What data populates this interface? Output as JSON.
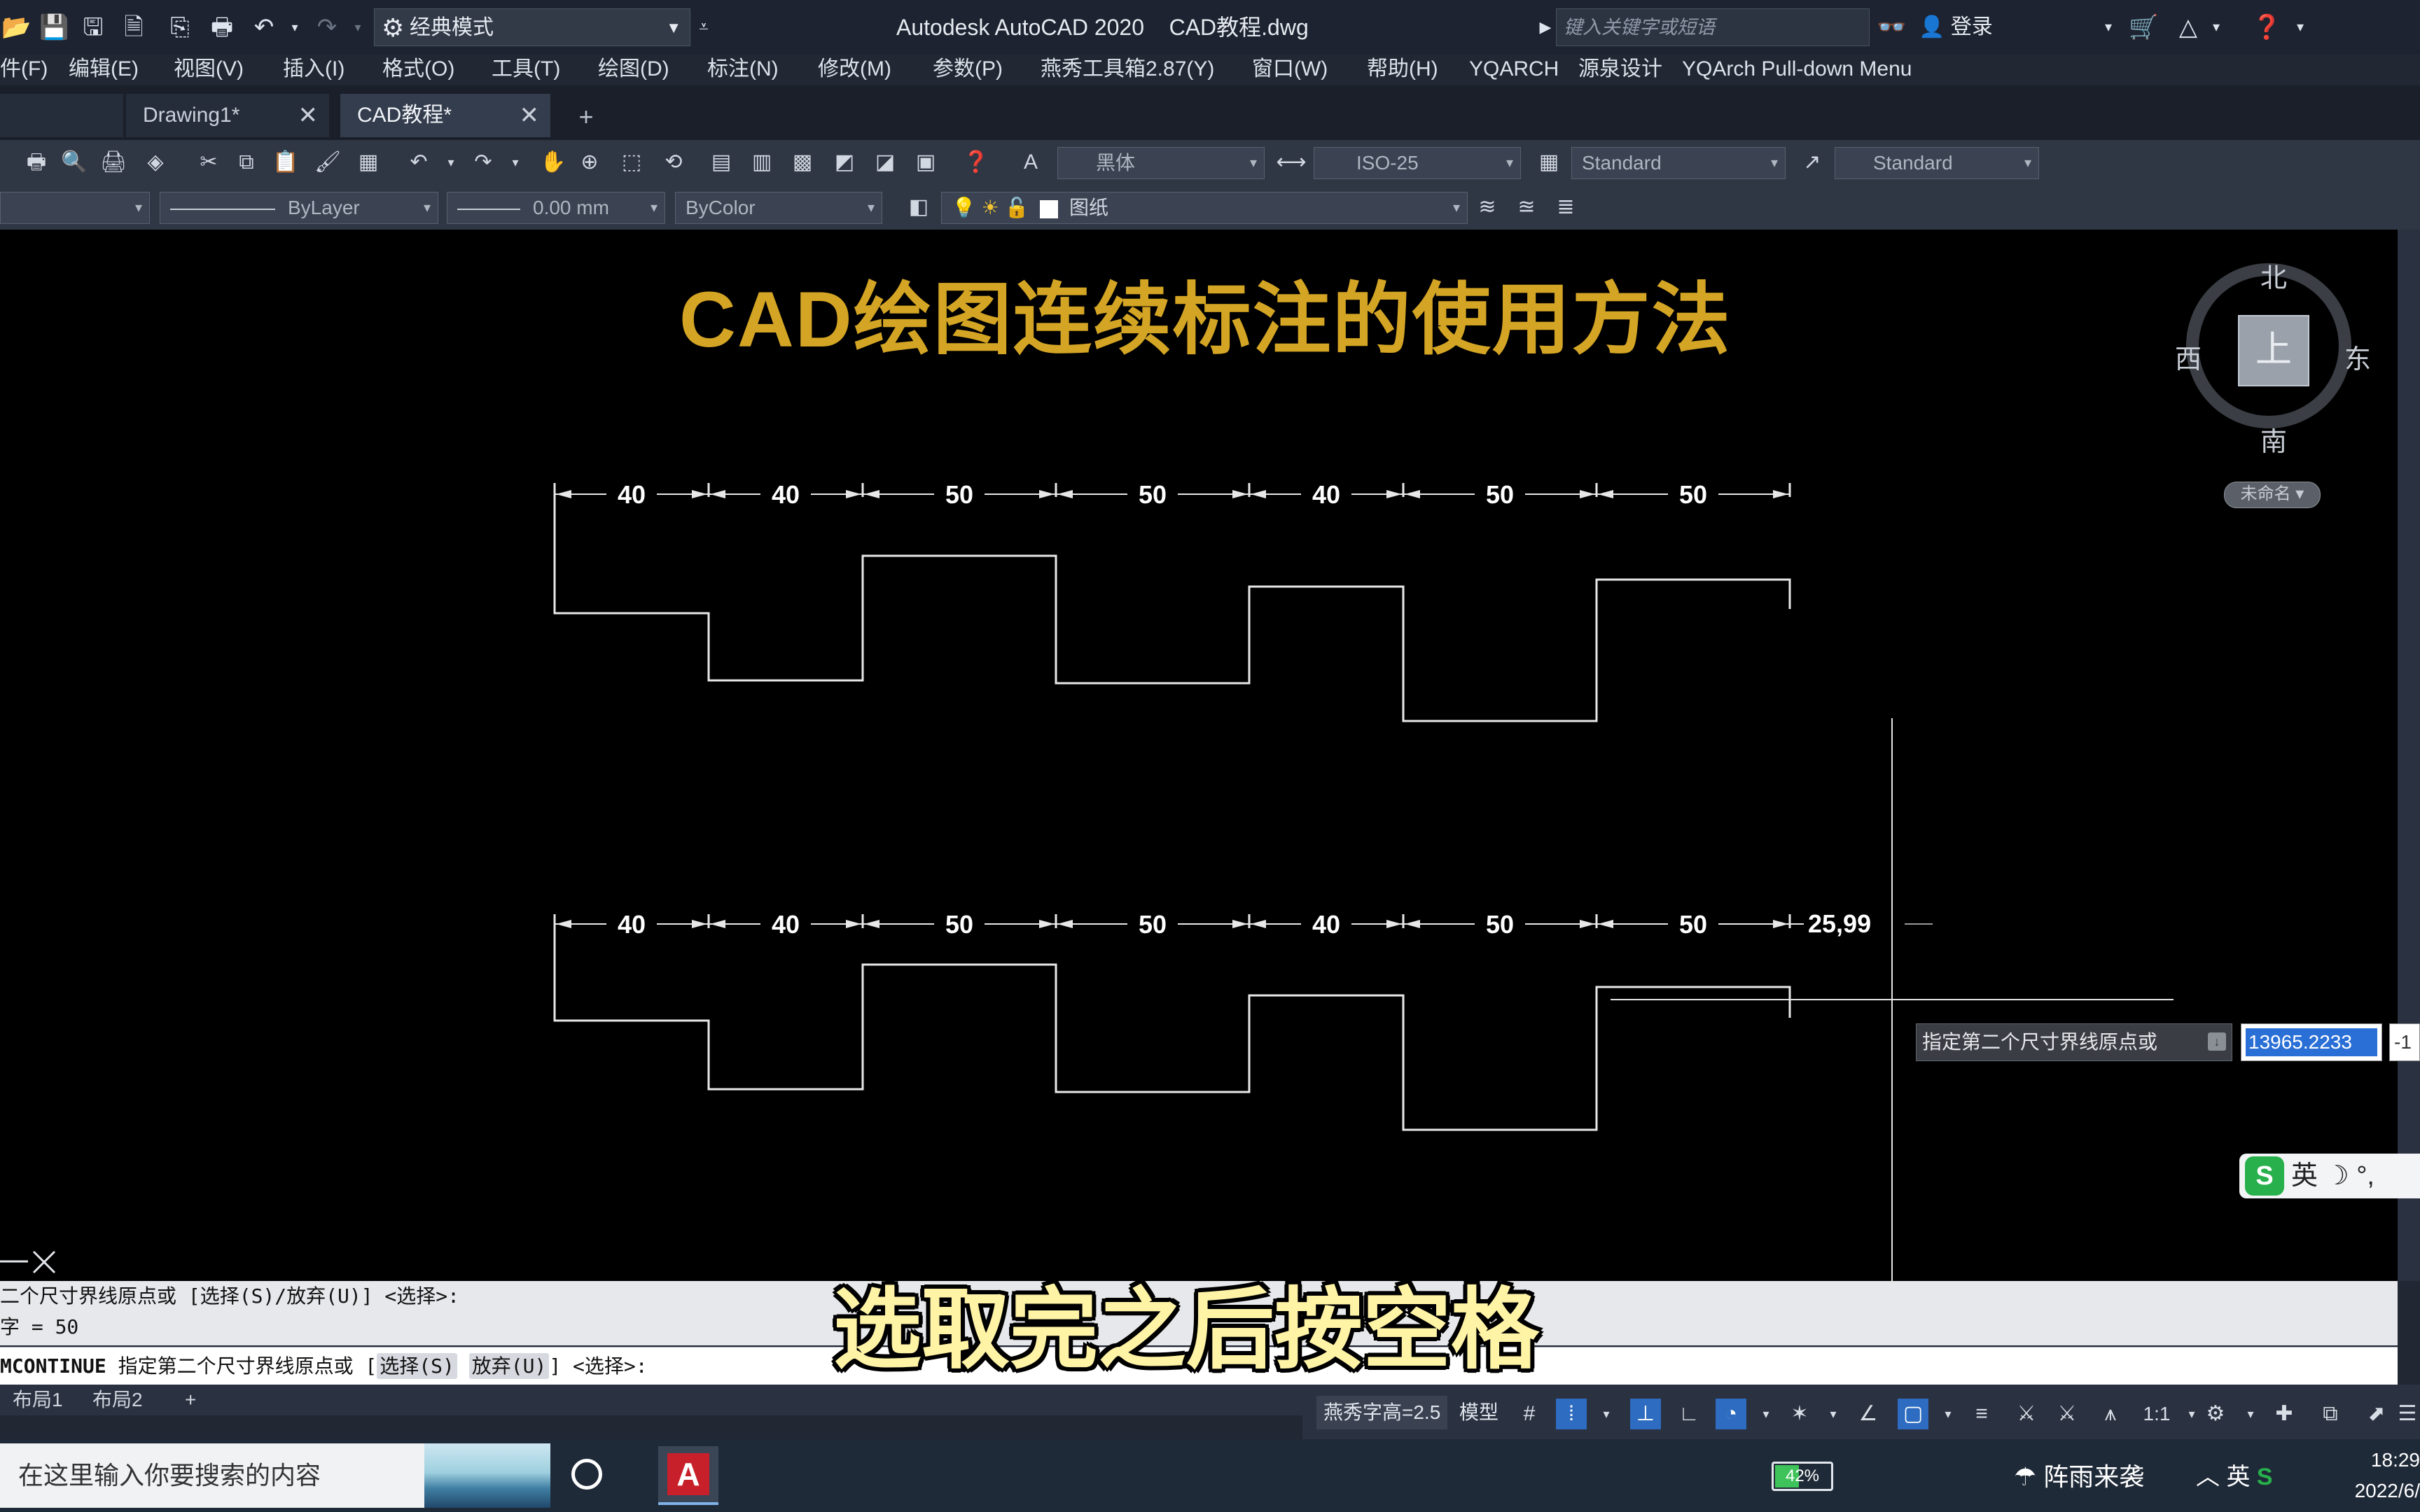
{
  "titlebar": {
    "workspace": "经典模式",
    "app_name": "Autodesk AutoCAD 2020",
    "file_name": "CAD教程.dwg",
    "search_placeholder": "键入关键字或短语",
    "login": "登录"
  },
  "menubar": {
    "items": [
      "件(F)",
      "编辑(E)",
      "视图(V)",
      "插入(I)",
      "格式(O)",
      "工具(T)",
      "绘图(D)",
      "标注(N)",
      "修改(M)",
      "参数(P)",
      "燕秀工具箱2.87(Y)",
      "窗口(W)",
      "帮助(H)",
      "YQARCH",
      "源泉设计",
      "YQArch Pull-down Menu"
    ]
  },
  "tabs": {
    "items": [
      {
        "label": "Drawing1*",
        "close": "✕"
      },
      {
        "label": "CAD教程*",
        "close": "✕"
      }
    ],
    "add": "+"
  },
  "toolbar": {
    "text_style_font": "黑体",
    "dim_style": "ISO-25",
    "table_style": "Standard",
    "multileader_style": "Standard",
    "linetype": "ByLayer",
    "lineweight": "0.00 mm",
    "plot_color": "ByColor",
    "layer": "图纸"
  },
  "drawing": {
    "title": "CAD绘图连续标注的使用方法",
    "top_dims": [
      "40",
      "40",
      "50",
      "50",
      "40",
      "50",
      "50"
    ],
    "bottom_dims": [
      "40",
      "40",
      "50",
      "50",
      "40",
      "50",
      "50"
    ],
    "preview_dim": "25,99"
  },
  "viewcube": {
    "north": "北",
    "south": "南",
    "east": "东",
    "west": "西",
    "face": "上",
    "wcs": "未命名"
  },
  "dynamic_input": {
    "prompt": "指定第二个尺寸界线原点或",
    "value": "13965.2233",
    "value2": "-1"
  },
  "ime": {
    "label": "英",
    "icons": "☽ °,"
  },
  "command": {
    "history1": "二个尺寸界线原点或 [选择(S)/放弃(U)] <选择>:",
    "history2": "字 = 50",
    "cmd_name": "MCONTINUE",
    "prompt_text": " 指定第二个尺寸界线原点或 [",
    "option1": "选择(S)",
    "option2": "放弃(U)",
    "prompt_end": "] <选择>:"
  },
  "subtitle": "选取完之后按空格",
  "layout_tabs": [
    "布局1",
    "布局2"
  ],
  "layout_add": "+",
  "statusbar": {
    "text_height": "燕秀字高=2.5",
    "model": "模型",
    "scale": "1:1"
  },
  "taskbar": {
    "search_placeholder": "在这里输入你要搜索的内容",
    "battery": "42%",
    "weather": "阵雨来袭",
    "ime": "英",
    "time": "18:29",
    "date": "2022/6/"
  }
}
